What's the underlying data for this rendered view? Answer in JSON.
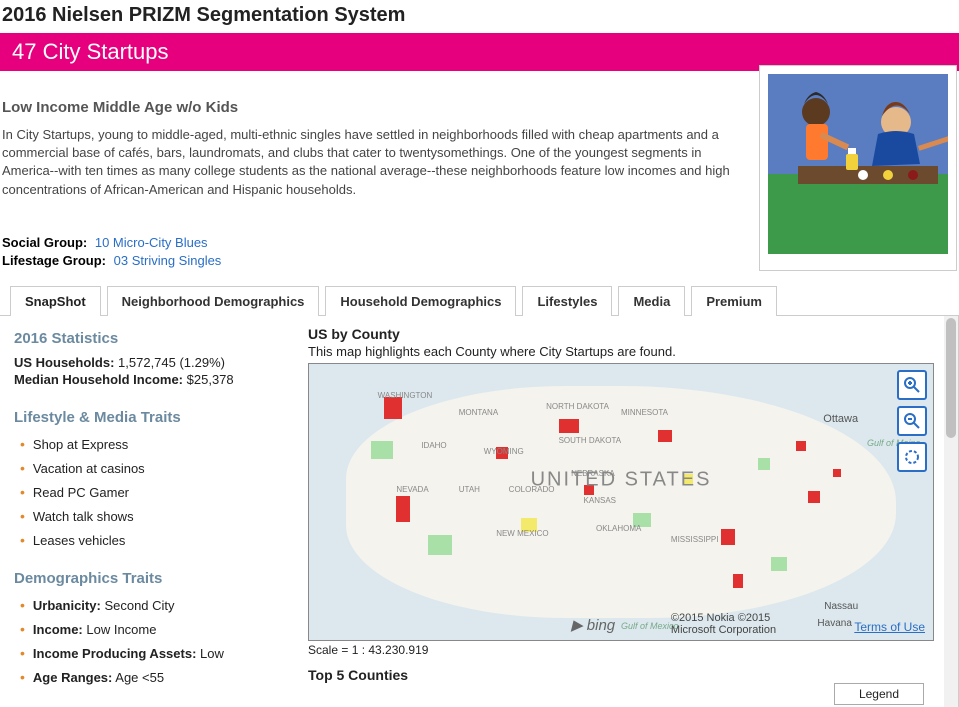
{
  "page_title": "2016 Nielsen PRIZM Segmentation System",
  "segment_header": "47 City Startups",
  "sub_header": "Low Income Middle Age w/o Kids",
  "description": "In City Startups, young to middle-aged, multi-ethnic singles have settled in neighborhoods filled with cheap apartments and a commercial base of cafés, bars, laundromats, and clubs that cater to twentysomethings. One of the youngest segments in America--with ten times as many college students as the national average--these neighborhoods feature low incomes and high concentrations of African-American and Hispanic households.",
  "groups": {
    "social_label": "Social Group:",
    "social_value": "10 Micro-City Blues",
    "lifestage_label": "Lifestage Group:",
    "lifestage_value": "03 Striving Singles"
  },
  "tabs": [
    "SnapShot",
    "Neighborhood Demographics",
    "Household Demographics",
    "Lifestyles",
    "Media",
    "Premium"
  ],
  "stats": {
    "heading": "2016 Statistics",
    "hh_label": "US Households:",
    "hh_value": "1,572,745 (1.29%)",
    "income_label": "Median Household Income:",
    "income_value": "$25,378"
  },
  "lifestyle_heading": "Lifestyle & Media Traits",
  "lifestyle_traits": [
    "Shop at Express",
    "Vacation at casinos",
    "Read PC Gamer",
    "Watch talk shows",
    "Leases vehicles"
  ],
  "demo_heading": "Demographics Traits",
  "demo_traits": [
    {
      "k": "Urbanicity:",
      "v": "Second City"
    },
    {
      "k": "Income:",
      "v": "Low Income"
    },
    {
      "k": "Income Producing Assets:",
      "v": "Low"
    },
    {
      "k": "Age Ranges:",
      "v": "Age <55"
    }
  ],
  "map": {
    "title": "US by County",
    "subtitle": "This map highlights each County where City Startups are found.",
    "center_label": "UNITED STATES",
    "ottawa": "Ottawa",
    "gulf_maine": "Gulf of Maine",
    "nassau": "Nassau",
    "havana": "Havana",
    "gulf_mex": "Gulf of Mexico",
    "bing": "bing",
    "copyright": "©2015 Nokia ©2015 Microsoft Corporation",
    "terms": "Terms of Use",
    "scale": "Scale = 1 : 43.230.919",
    "states": [
      "WASHINGTON",
      "MONTANA",
      "NORTH DAKOTA",
      "MINNESOTA",
      "IDAHO",
      "WYOMING",
      "SOUTH DAKOTA",
      "NEVADA",
      "UTAH",
      "COLORADO",
      "NEBRASKA",
      "KANSAS",
      "NEW MEXICO",
      "OKLAHOMA",
      "MISSISSIPPI"
    ]
  },
  "top5_heading": "Top 5 Counties",
  "legend_label": "Legend"
}
